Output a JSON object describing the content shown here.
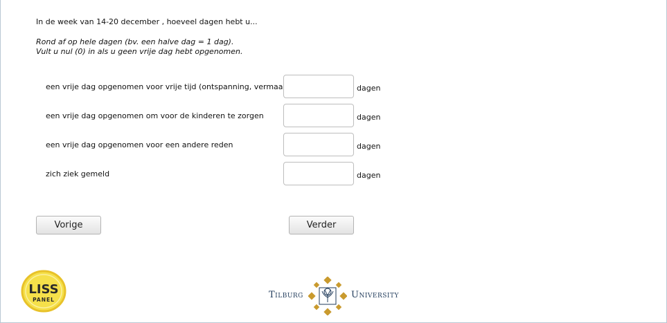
{
  "question": "In de week van 14-20 december , hoeveel dagen hebt u...",
  "instructions": [
    "Rond af op hele dagen (bv. een halve dag = 1 dag).",
    "Vult u nul (0) in als u geen vrije dag hebt opgenomen."
  ],
  "rows": [
    {
      "label": "een vrije dag opgenomen voor vrije tijd (ontspanning, vermaak)",
      "value": "",
      "unit": "dagen"
    },
    {
      "label": "een vrije dag opgenomen om voor de kinderen te zorgen",
      "value": "",
      "unit": "dagen"
    },
    {
      "label": "een vrije dag opgenomen voor een andere reden",
      "value": "",
      "unit": "dagen"
    },
    {
      "label": "zich ziek gemeld",
      "value": "",
      "unit": "dagen"
    }
  ],
  "buttons": {
    "back_label": "Vorige",
    "next_label": "Verder"
  },
  "logos": {
    "liss_top": "LISS",
    "liss_bottom": "PANEL",
    "tilburg_left": "Tilburg",
    "tilburg_right": "University"
  },
  "colors": {
    "liss_yellow": "#f5e04a",
    "liss_ring": "#e8c22a",
    "tilburg_gold": "#c99a2e",
    "tilburg_navy": "#1f3a5a"
  }
}
